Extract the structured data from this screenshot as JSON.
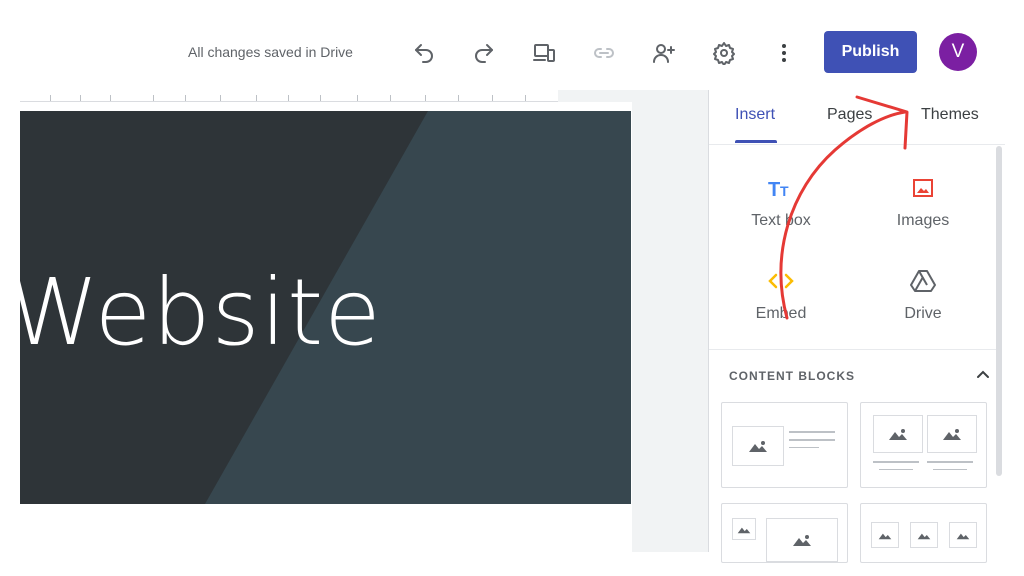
{
  "toolbar": {
    "save_status": "All changes saved in Drive",
    "icons": [
      "undo-icon",
      "redo-icon",
      "preview-devices-icon",
      "link-icon",
      "share-icon",
      "settings-icon",
      "more-vert-icon"
    ],
    "publish_label": "Publish",
    "avatar_letter": "V",
    "accent_color": "#3f51b5",
    "avatar_color": "#7b1fa2"
  },
  "canvas": {
    "hero_title": "Website"
  },
  "sidebar": {
    "tabs": [
      {
        "label": "Insert",
        "active": true
      },
      {
        "label": "Pages",
        "active": false
      },
      {
        "label": "Themes",
        "active": false
      }
    ],
    "insert_items": [
      {
        "label": "Text box",
        "icon": "text-box-icon"
      },
      {
        "label": "Images",
        "icon": "image-icon"
      },
      {
        "label": "Embed",
        "icon": "embed-icon"
      },
      {
        "label": "Drive",
        "icon": "drive-icon"
      }
    ],
    "content_blocks_title": "CONTENT BLOCKS"
  },
  "annotation": {
    "arrow_color": "#e53935"
  }
}
